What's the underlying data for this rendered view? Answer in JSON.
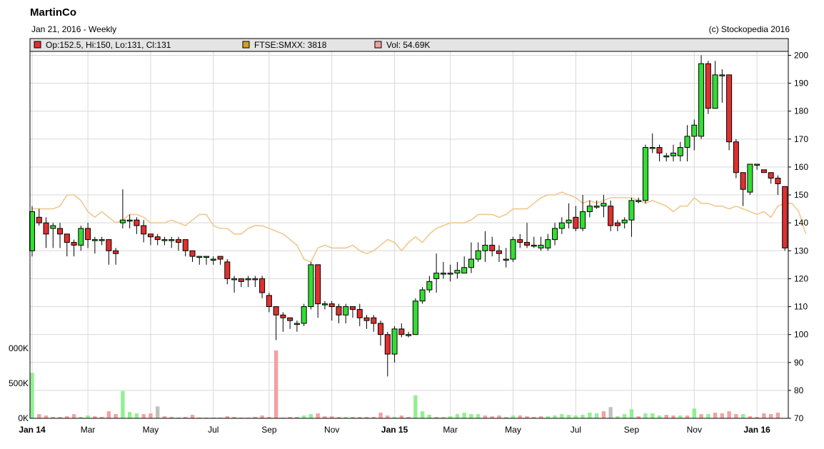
{
  "header": {
    "title": "MartinCo",
    "subtitle": "Jan 21, 2016 - Weekly",
    "copyright": "(c) Stockopedia 2016"
  },
  "legend": [
    {
      "label": "Op:152.5, Hi:150, Lo:131, Cl:131",
      "color": "#e03030"
    },
    {
      "label": "FTSE:SMXX: 3818",
      "color": "#d4a020"
    },
    {
      "label": "Vol: 54.69K",
      "color": "#f4a0a0"
    }
  ],
  "colors": {
    "up": "#33dd33",
    "down": "#e03030",
    "index_line": "#f0c890",
    "vol_up": "#90f090",
    "vol_down": "#f4a0a0",
    "vol_neutral": "#c0c0c0",
    "grid": "#d8d8d8",
    "legend_bg": "#e4e4e4"
  },
  "chart_data": {
    "type": "candlestick",
    "price_axis": {
      "ticks": [
        70,
        80,
        90,
        100,
        110,
        120,
        130,
        140,
        150,
        160,
        170,
        180,
        190,
        200
      ],
      "range": [
        70,
        206
      ],
      "side": "right"
    },
    "volume_axis": {
      "ticks": [
        0,
        500000,
        1000000
      ],
      "labels": [
        "0K",
        "500K",
        "000K"
      ],
      "side": "left"
    },
    "x_labels": [
      {
        "label": "Jan 14",
        "week": 0,
        "bold": true
      },
      {
        "label": "Mar",
        "week": 8,
        "bold": false
      },
      {
        "label": "May",
        "week": 17,
        "bold": false
      },
      {
        "label": "Jul",
        "week": 26,
        "bold": false
      },
      {
        "label": "Sep",
        "week": 34,
        "bold": false
      },
      {
        "label": "Nov",
        "week": 43,
        "bold": false
      },
      {
        "label": "Jan 15",
        "week": 52,
        "bold": true
      },
      {
        "label": "Mar",
        "week": 60,
        "bold": false
      },
      {
        "label": "May",
        "week": 69,
        "bold": false
      },
      {
        "label": "Jul",
        "week": 78,
        "bold": false
      },
      {
        "label": "Sep",
        "week": 86,
        "bold": false
      },
      {
        "label": "Nov",
        "week": 95,
        "bold": false
      },
      {
        "label": "Jan 16",
        "week": 104,
        "bold": true
      }
    ],
    "candles": [
      [
        130,
        144,
        128,
        146
      ],
      [
        142,
        140,
        139,
        145
      ],
      [
        140,
        136,
        131,
        142
      ],
      [
        138,
        139,
        131,
        140
      ],
      [
        138,
        136,
        131,
        140
      ],
      [
        136,
        133,
        128,
        136
      ],
      [
        133,
        132,
        128,
        134
      ],
      [
        132,
        138,
        130,
        139
      ],
      [
        138,
        134,
        131,
        140
      ],
      [
        134,
        134,
        129,
        135
      ],
      [
        134,
        134,
        132,
        135
      ],
      [
        134,
        130,
        125,
        134
      ],
      [
        130,
        129,
        125,
        131
      ],
      [
        140,
        141,
        138,
        152
      ],
      [
        141,
        141,
        138,
        143
      ],
      [
        141,
        139,
        136,
        142
      ],
      [
        139,
        136,
        133,
        141
      ],
      [
        136,
        135,
        132,
        136
      ],
      [
        135,
        134,
        132,
        136
      ],
      [
        134,
        134,
        132,
        135
      ],
      [
        134,
        134,
        131,
        135
      ],
      [
        134,
        133,
        130,
        135
      ],
      [
        134,
        130,
        128,
        134
      ],
      [
        130,
        128,
        126,
        130
      ],
      [
        128,
        128,
        125,
        128
      ],
      [
        128,
        128,
        125,
        128
      ],
      [
        127,
        127,
        125,
        128
      ],
      [
        128,
        127,
        125,
        128
      ],
      [
        126,
        120,
        118,
        127
      ],
      [
        120,
        120,
        115,
        121
      ],
      [
        120,
        119,
        117,
        120
      ],
      [
        120,
        120,
        117,
        121
      ],
      [
        120,
        120,
        117,
        121
      ],
      [
        120,
        115,
        113,
        121
      ],
      [
        114,
        110,
        108,
        115
      ],
      [
        110,
        107,
        98,
        110
      ],
      [
        107,
        106,
        101,
        108
      ],
      [
        106,
        105,
        102,
        106
      ],
      [
        104,
        104,
        101,
        105
      ],
      [
        104,
        110,
        103,
        111
      ],
      [
        110,
        125,
        109,
        126
      ],
      [
        125,
        111,
        106,
        125
      ],
      [
        111,
        111,
        109,
        112
      ],
      [
        111,
        110,
        105,
        112
      ],
      [
        110,
        107,
        104,
        111
      ],
      [
        107,
        110,
        104,
        111
      ],
      [
        110,
        109,
        106,
        110
      ],
      [
        109,
        106,
        103,
        111
      ],
      [
        106,
        105,
        102,
        107
      ],
      [
        106,
        104,
        101,
        107
      ],
      [
        104,
        100,
        96,
        105
      ],
      [
        100,
        93,
        85,
        101
      ],
      [
        93,
        102,
        90,
        103
      ],
      [
        102,
        100,
        99,
        104
      ],
      [
        100,
        100,
        99,
        101
      ],
      [
        100,
        112,
        100,
        113
      ],
      [
        112,
        116,
        111,
        117
      ],
      [
        116,
        119,
        115,
        121
      ],
      [
        120,
        122,
        115,
        129
      ],
      [
        122,
        122,
        120,
        126
      ],
      [
        122,
        122,
        119,
        125
      ],
      [
        122,
        123,
        120,
        126
      ],
      [
        122,
        124,
        122,
        128
      ],
      [
        124,
        127,
        122,
        133
      ],
      [
        127,
        130,
        126,
        133
      ],
      [
        130,
        132,
        126,
        137
      ],
      [
        132,
        130,
        128,
        135
      ],
      [
        130,
        129,
        126,
        132
      ],
      [
        127,
        127,
        124,
        131
      ],
      [
        127,
        134,
        126,
        135
      ],
      [
        134,
        133,
        131,
        136
      ],
      [
        133,
        132,
        131,
        140
      ],
      [
        132,
        132,
        131,
        135
      ],
      [
        131,
        132,
        130,
        135
      ],
      [
        131,
        134,
        130,
        136
      ],
      [
        134,
        138,
        132,
        140
      ],
      [
        138,
        140,
        136,
        142
      ],
      [
        140,
        141,
        138,
        147
      ],
      [
        142,
        138,
        137,
        146
      ],
      [
        138,
        144,
        137,
        150
      ],
      [
        144,
        146,
        142,
        148
      ],
      [
        146,
        146,
        145,
        148
      ],
      [
        146,
        147,
        142,
        150
      ],
      [
        146,
        139,
        137,
        148
      ],
      [
        140,
        139,
        137,
        141
      ],
      [
        140,
        141,
        138,
        142
      ],
      [
        141,
        148,
        135,
        149
      ],
      [
        148,
        148,
        147,
        149
      ],
      [
        148,
        167,
        147,
        168
      ],
      [
        167,
        167,
        165,
        172
      ],
      [
        167,
        165,
        162,
        168
      ],
      [
        164,
        164,
        162,
        165
      ],
      [
        164,
        165,
        162,
        168
      ],
      [
        164,
        167,
        162,
        169
      ],
      [
        167,
        171,
        162,
        175
      ],
      [
        171,
        175,
        166,
        177
      ],
      [
        171,
        197,
        170,
        200
      ],
      [
        197,
        181,
        179,
        198
      ],
      [
        181,
        193,
        181,
        198
      ],
      [
        193,
        193,
        183,
        195
      ],
      [
        193,
        169,
        166,
        193
      ],
      [
        169,
        158,
        156,
        170
      ],
      [
        158,
        152,
        146,
        158
      ],
      [
        151,
        161,
        150,
        161
      ],
      [
        161,
        161,
        159,
        161
      ],
      [
        159,
        158,
        158,
        159
      ],
      [
        158,
        156,
        154,
        158
      ],
      [
        156,
        154,
        150,
        157
      ],
      [
        153,
        131,
        130,
        153
      ]
    ],
    "index_line": [
      145,
      145,
      145,
      145,
      146,
      150,
      150,
      148,
      144,
      142,
      144,
      142,
      140,
      141,
      143,
      143,
      142,
      140,
      140,
      140,
      141,
      140,
      139,
      141,
      143,
      143,
      139,
      138,
      138,
      136,
      136,
      138,
      139,
      139,
      138,
      137,
      136,
      134,
      132,
      127,
      126,
      131,
      132,
      131,
      131,
      131,
      132,
      130,
      129,
      130,
      132,
      134,
      133,
      130,
      133,
      135,
      133,
      136,
      138,
      139,
      140,
      140,
      140,
      141,
      143,
      143,
      143,
      142,
      143,
      145,
      145,
      145,
      147,
      149,
      150,
      150,
      151,
      150,
      149,
      147,
      148,
      147,
      148,
      149,
      149,
      149,
      149,
      148,
      147,
      148,
      147,
      146,
      144,
      146,
      146,
      149,
      147,
      147,
      146,
      146,
      145,
      146,
      145,
      144,
      143,
      144,
      142,
      146,
      147,
      147,
      144,
      136
    ],
    "volume": [
      [
        650000,
        "up"
      ],
      [
        60000,
        "down"
      ],
      [
        40000,
        "down"
      ],
      [
        20000,
        "down"
      ],
      [
        20000,
        "down"
      ],
      [
        30000,
        "down"
      ],
      [
        60000,
        "down"
      ],
      [
        20000,
        "up"
      ],
      [
        40000,
        "up"
      ],
      [
        30000,
        "down"
      ],
      [
        20000,
        "down"
      ],
      [
        100000,
        "down"
      ],
      [
        60000,
        "down"
      ],
      [
        390000,
        "up"
      ],
      [
        90000,
        "up"
      ],
      [
        70000,
        "up"
      ],
      [
        60000,
        "down"
      ],
      [
        70000,
        "down"
      ],
      [
        170000,
        "neutral"
      ],
      [
        30000,
        "down"
      ],
      [
        20000,
        "down"
      ],
      [
        10000,
        "down"
      ],
      [
        20000,
        "down"
      ],
      [
        50000,
        "down"
      ],
      [
        10000,
        "down"
      ],
      [
        10000,
        "down"
      ],
      [
        10000,
        "down"
      ],
      [
        10000,
        "down"
      ],
      [
        30000,
        "down"
      ],
      [
        20000,
        "down"
      ],
      [
        10000,
        "down"
      ],
      [
        10000,
        "down"
      ],
      [
        20000,
        "down"
      ],
      [
        40000,
        "down"
      ],
      [
        20000,
        "down"
      ],
      [
        970000,
        "down"
      ],
      [
        10000,
        "down"
      ],
      [
        20000,
        "down"
      ],
      [
        20000,
        "down"
      ],
      [
        40000,
        "up"
      ],
      [
        60000,
        "up"
      ],
      [
        70000,
        "down"
      ],
      [
        30000,
        "down"
      ],
      [
        30000,
        "down"
      ],
      [
        20000,
        "down"
      ],
      [
        20000,
        "up"
      ],
      [
        20000,
        "down"
      ],
      [
        20000,
        "down"
      ],
      [
        20000,
        "down"
      ],
      [
        20000,
        "down"
      ],
      [
        80000,
        "down"
      ],
      [
        40000,
        "down"
      ],
      [
        20000,
        "up"
      ],
      [
        40000,
        "down"
      ],
      [
        20000,
        "down"
      ],
      [
        330000,
        "up"
      ],
      [
        100000,
        "up"
      ],
      [
        50000,
        "up"
      ],
      [
        20000,
        "down"
      ],
      [
        20000,
        "up"
      ],
      [
        30000,
        "up"
      ],
      [
        60000,
        "up"
      ],
      [
        80000,
        "up"
      ],
      [
        60000,
        "up"
      ],
      [
        60000,
        "up"
      ],
      [
        40000,
        "down"
      ],
      [
        30000,
        "down"
      ],
      [
        40000,
        "down"
      ],
      [
        20000,
        "neutral"
      ],
      [
        40000,
        "up"
      ],
      [
        40000,
        "down"
      ],
      [
        30000,
        "down"
      ],
      [
        20000,
        "down"
      ],
      [
        30000,
        "down"
      ],
      [
        30000,
        "up"
      ],
      [
        40000,
        "up"
      ],
      [
        60000,
        "up"
      ],
      [
        50000,
        "up"
      ],
      [
        40000,
        "up"
      ],
      [
        50000,
        "up"
      ],
      [
        80000,
        "up"
      ],
      [
        70000,
        "up"
      ],
      [
        100000,
        "down"
      ],
      [
        160000,
        "neutral"
      ],
      [
        30000,
        "up"
      ],
      [
        60000,
        "up"
      ],
      [
        130000,
        "up"
      ],
      [
        30000,
        "down"
      ],
      [
        70000,
        "up"
      ],
      [
        70000,
        "up"
      ],
      [
        40000,
        "up"
      ],
      [
        50000,
        "down"
      ],
      [
        40000,
        "down"
      ],
      [
        40000,
        "up"
      ],
      [
        40000,
        "down"
      ],
      [
        140000,
        "up"
      ],
      [
        60000,
        "down"
      ],
      [
        60000,
        "up"
      ],
      [
        80000,
        "down"
      ],
      [
        70000,
        "down"
      ],
      [
        100000,
        "down"
      ],
      [
        60000,
        "down"
      ],
      [
        60000,
        "up"
      ],
      [
        30000,
        "down"
      ],
      [
        20000,
        "down"
      ],
      [
        70000,
        "down"
      ],
      [
        60000,
        "down"
      ],
      [
        80000,
        "down"
      ]
    ]
  }
}
